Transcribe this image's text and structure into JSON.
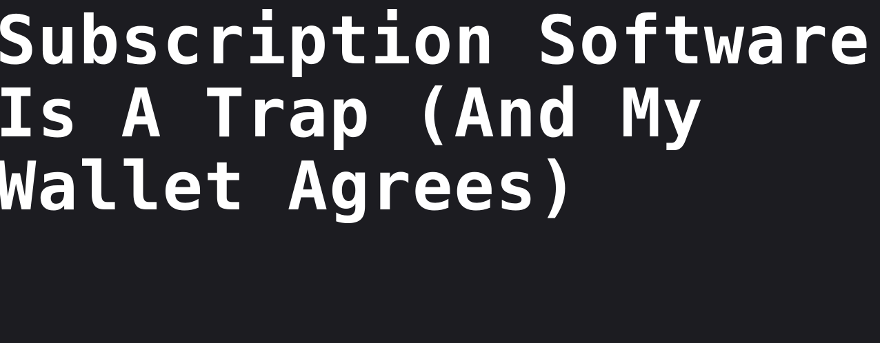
{
  "colors": {
    "background": "#1c1c21",
    "text": "#ffffff"
  },
  "headline": {
    "lines": [
      "Subscription Software",
      "Is A Trap (And My",
      "Wallet Agrees)"
    ]
  }
}
